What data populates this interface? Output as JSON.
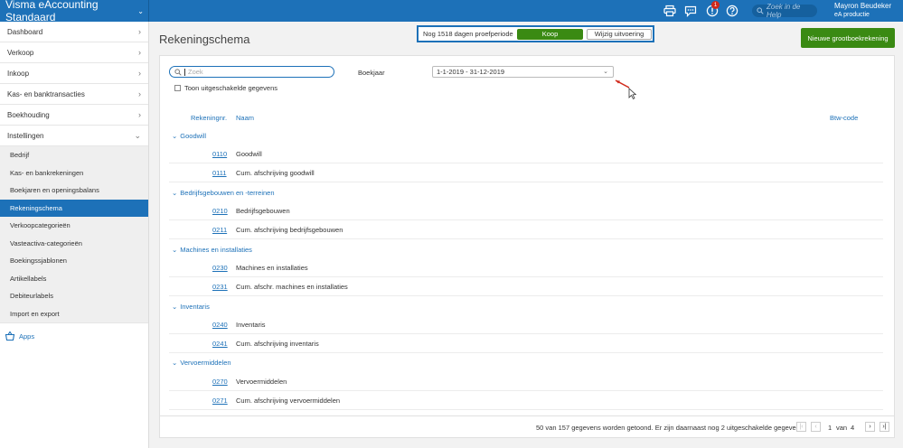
{
  "app": {
    "title": "Visma eAccounting Standaard"
  },
  "topbar": {
    "help_placeholder": "Zoek in de Help",
    "notification_count": "1",
    "user_name": "Mayron Beudeker",
    "user_org": "eA productie",
    "icons": [
      "print-icon",
      "chat-icon",
      "notification-icon",
      "help-icon",
      "search-icon"
    ]
  },
  "sidebar": {
    "items": [
      {
        "label": "Dashboard"
      },
      {
        "label": "Verkoop"
      },
      {
        "label": "Inkoop"
      },
      {
        "label": "Kas- en banktransacties"
      },
      {
        "label": "Boekhouding"
      },
      {
        "label": "Instellingen"
      }
    ],
    "sub_items": [
      {
        "label": "Bedrijf"
      },
      {
        "label": "Kas- en bankrekeningen"
      },
      {
        "label": "Boekjaren en openingsbalans"
      },
      {
        "label": "Rekeningschema"
      },
      {
        "label": "Verkoopcategorieën"
      },
      {
        "label": "Vasteactiva-categorieën"
      },
      {
        "label": "Boekingssjablonen"
      },
      {
        "label": "Artikellabels"
      },
      {
        "label": "Debiteurlabels"
      },
      {
        "label": "Import en export"
      }
    ],
    "apps_label": "Apps"
  },
  "header": {
    "page_title": "Rekeningschema",
    "trial_text": "Nog 1518 dagen proefperiode",
    "buy_label": "Koop",
    "change_label": "Wijzig uitvoering",
    "new_label": "Nieuwe grootboekrekening"
  },
  "filters": {
    "search_placeholder": "Zoek",
    "boekjaar_label": "Boekjaar",
    "boekjaar_value": "1-1-2019 - 31-12-2019",
    "show_disabled_label": "Toon uitgeschakelde gegevens"
  },
  "table": {
    "columns": {
      "nr": "Rekeningnr.",
      "name": "Naam",
      "vat": "Btw-code"
    },
    "groups": [
      {
        "name": "Goodwill",
        "rows": [
          {
            "nr": "0110",
            "name": "Goodwill"
          },
          {
            "nr": "0111",
            "name": "Cum. afschrijving goodwill"
          }
        ]
      },
      {
        "name": "Bedrijfsgebouwen en -terreinen",
        "rows": [
          {
            "nr": "0210",
            "name": "Bedrijfsgebouwen"
          },
          {
            "nr": "0211",
            "name": "Cum. afschrijving bedrijfsgebouwen"
          }
        ]
      },
      {
        "name": "Machines en installaties",
        "rows": [
          {
            "nr": "0230",
            "name": "Machines en installaties"
          },
          {
            "nr": "0231",
            "name": "Cum. afschr. machines en installaties"
          }
        ]
      },
      {
        "name": "Inventaris",
        "rows": [
          {
            "nr": "0240",
            "name": "Inventaris"
          },
          {
            "nr": "0241",
            "name": "Cum. afschrijving inventaris"
          }
        ]
      },
      {
        "name": "Vervoermiddelen",
        "rows": [
          {
            "nr": "0270",
            "name": "Vervoermiddelen"
          },
          {
            "nr": "0271",
            "name": "Cum. afschrijving vervoermiddelen"
          }
        ]
      }
    ]
  },
  "footer": {
    "info": "50 van 157 gegevens worden getoond. Er zijn daarnaast nog 2 uitgeschakelde gegevens.",
    "page": "1",
    "of_label": "van",
    "total_pages": "4"
  },
  "colors": {
    "primary": "#1d71b8",
    "success": "#3a8a13",
    "badge": "#d0281a"
  }
}
